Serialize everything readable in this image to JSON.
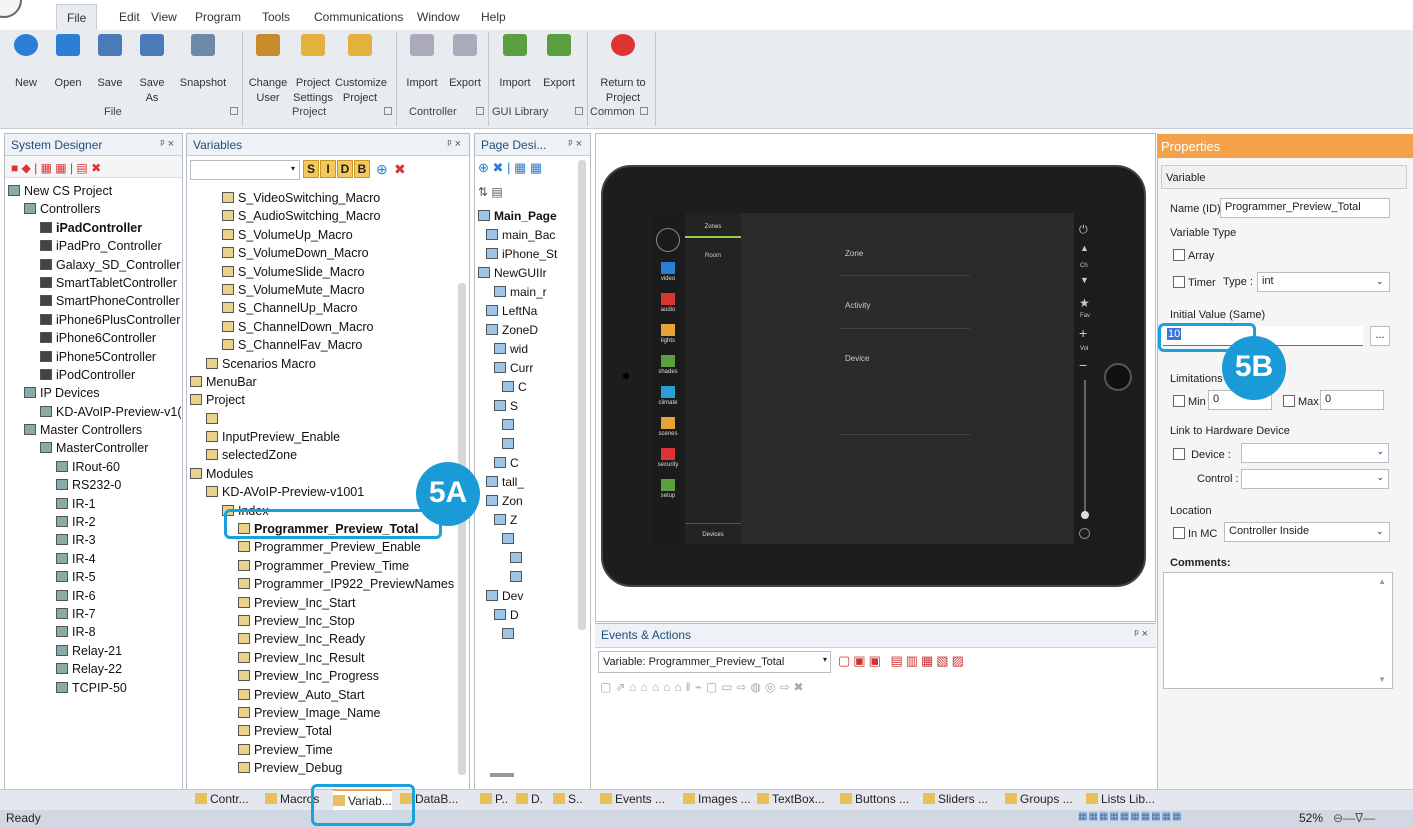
{
  "menu": {
    "items": [
      "File",
      "Edit",
      "View",
      "Program",
      "Tools",
      "Communications",
      "Window",
      "Help"
    ]
  },
  "ribbon": {
    "buttons": [
      {
        "label": "New",
        "icon": "new-icon"
      },
      {
        "label": "Open",
        "icon": "open-icon"
      },
      {
        "label": "Save",
        "icon": "save-icon"
      },
      {
        "label": "Save As",
        "icon": "save-as-icon"
      },
      {
        "label": "Snapshot",
        "icon": "snapshot-icon"
      },
      {
        "label": "Change User",
        "icon": "change-user-icon"
      },
      {
        "label": "Project Settings",
        "icon": "project-settings-icon"
      },
      {
        "label": "Customize Project",
        "icon": "customize-project-icon"
      },
      {
        "label": "Import",
        "icon": "import-icon"
      },
      {
        "label": "Export",
        "icon": "export-icon"
      },
      {
        "label": "Import",
        "icon": "import-icon"
      },
      {
        "label": "Export",
        "icon": "export-icon"
      },
      {
        "label": "Return to Project",
        "icon": "return-icon"
      }
    ],
    "groups": [
      "File",
      "Project",
      "Controller",
      "GUI Library",
      "Common"
    ]
  },
  "system_designer": {
    "title": "System Designer",
    "pin": "p ×",
    "items": [
      "New CS Project",
      "Controllers",
      "iPadController",
      "iPadPro_Controller",
      "Galaxy_SD_Controller",
      "SmartTabletController",
      "SmartPhoneController",
      "iPhone6PlusController",
      "iPhone6Controller",
      "iPhone5Controller",
      "iPodController",
      "IP Devices",
      "KD-AVoIP-Preview-v1(",
      "Master Controllers",
      "MasterController",
      "IRout-60",
      "RS232-0",
      "IR-1",
      "IR-2",
      "IR-3",
      "IR-4",
      "IR-5",
      "IR-6",
      "IR-7",
      "IR-8",
      "Relay-21",
      "Relay-22",
      "TCPIP-50"
    ]
  },
  "variables": {
    "title": "Variables",
    "type_buttons": [
      "S",
      "I",
      "D",
      "B"
    ],
    "items": [
      "S_VideoSwitching_Macro",
      "S_AudioSwitching_Macro",
      "S_VolumeUp_Macro",
      "S_VolumeDown_Macro",
      "S_VolumeSlide_Macro",
      "S_VolumeMute_Macro",
      "S_ChannelUp_Macro",
      "S_ChannelDown_Macro",
      "S_ChannelFav_Macro",
      "Scenarios Macro",
      "MenuBar",
      "Project",
      "",
      "InputPreview_Enable",
      "selectedZone",
      "Modules",
      "KD-AVoIP-Preview-v1001",
      "Index",
      "Programmer_Preview_Total",
      "Programmer_Preview_Enable",
      "Programmer_Preview_Time",
      "Programmer_IP922_PreviewNames",
      "Preview_Inc_Start",
      "Preview_Inc_Stop",
      "Preview_Inc_Ready",
      "Preview_Inc_Result",
      "Preview_Inc_Progress",
      "Preview_Auto_Start",
      "Preview_Image_Name",
      "Preview_Total",
      "Preview_Time",
      "Preview_Debug"
    ]
  },
  "page_designer": {
    "title": "Page Desi...",
    "items": [
      "Main_Page",
      "main_Bac",
      "iPhone_St",
      "NewGUIIr",
      "main_r",
      "LeftNa",
      "ZoneD",
      "wid",
      "Curr",
      "C",
      "S",
      "",
      "",
      "C",
      "tall_",
      "Zon",
      "Z",
      "",
      "",
      "",
      "Dev",
      "D",
      ""
    ]
  },
  "tablet": {
    "zones_tab": "Zones",
    "room": "Room",
    "devices": "Devices",
    "labels": [
      "Zone",
      "Activity",
      "Device"
    ],
    "side": [
      "video",
      "audio",
      "lights",
      "shades",
      "climate",
      "scenes",
      "security",
      "setup"
    ],
    "right": [
      "Ch",
      "Fav",
      "Vol"
    ]
  },
  "events": {
    "title": "Events & Actions",
    "variable": "Variable: Programmer_Preview_Total"
  },
  "properties": {
    "title": "Properties",
    "section": "Variable",
    "name_label": "Name (ID)",
    "name_value": "Programmer_Preview_Total",
    "variable_type": "Variable Type",
    "array": "Array",
    "timer": "Timer",
    "type_label": "Type :",
    "type_value": "int",
    "initial_value": "Initial Value (Same)",
    "initial": "10",
    "browse": "...",
    "limitations": "Limitations",
    "min": "Min",
    "min_value": "0",
    "max": "Max",
    "max_value": "0",
    "link": "Link to Hardware Device",
    "device": "Device :",
    "control": "Control :",
    "location": "Location",
    "in_mc": "In MC",
    "location_value": "Controller Inside",
    "comments": "Comments:"
  },
  "bottom_tabs": [
    "Contr...",
    "Macros",
    "Variab...",
    "DataB...",
    "P..",
    "D.",
    "S..",
    "Events ...",
    "Images ...",
    "TextBox...",
    "Buttons ...",
    "Sliders ...",
    "Groups ...",
    "Lists Lib..."
  ],
  "status": {
    "text": "Ready",
    "zoom": "52%"
  },
  "callouts": {
    "a": "5A",
    "b": "5B"
  },
  "colors": {
    "accent": "#1a9bd7",
    "properties_header": "#f3a24a"
  }
}
